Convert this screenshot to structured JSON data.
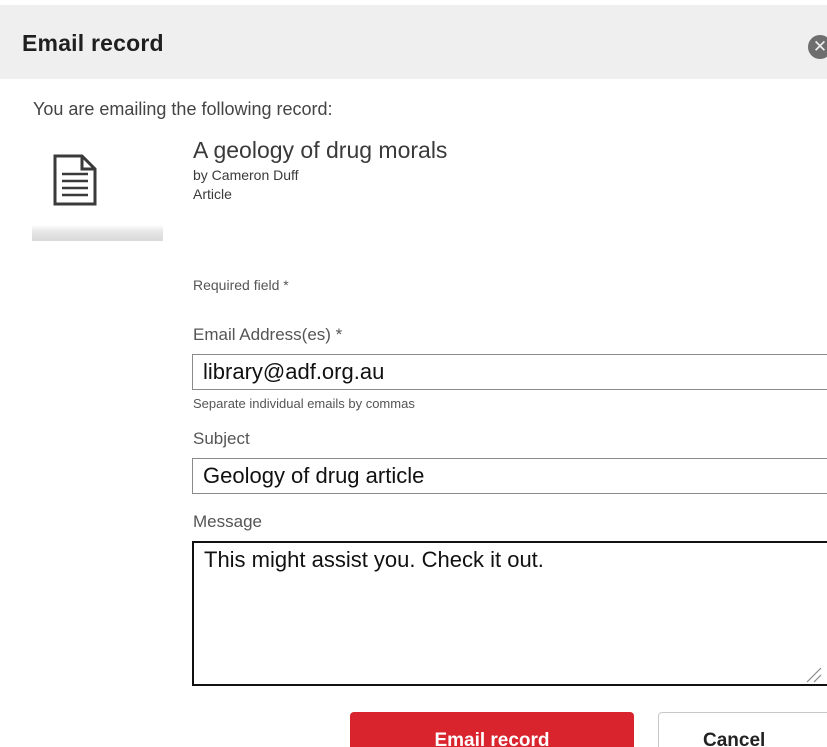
{
  "dialog": {
    "title": "Email record",
    "close_icon": "close-icon"
  },
  "intro": "You are emailing the following record:",
  "record": {
    "icon": "document-icon",
    "title": "A geology of drug morals",
    "author": "by Cameron Duff",
    "format": "Article"
  },
  "form": {
    "required_note": "Required field *",
    "email": {
      "label": "Email Address(es) *",
      "value": "library@adf.org.au",
      "help": "Separate individual emails by commas"
    },
    "subject": {
      "label": "Subject",
      "value": "Geology of drug article"
    },
    "message": {
      "label": "Message",
      "value": "This might assist you. Check it out."
    }
  },
  "buttons": {
    "submit_label": "Email record",
    "cancel_label": "Cancel"
  },
  "colors": {
    "header_bg": "#efefef",
    "primary": "#d9232d"
  }
}
